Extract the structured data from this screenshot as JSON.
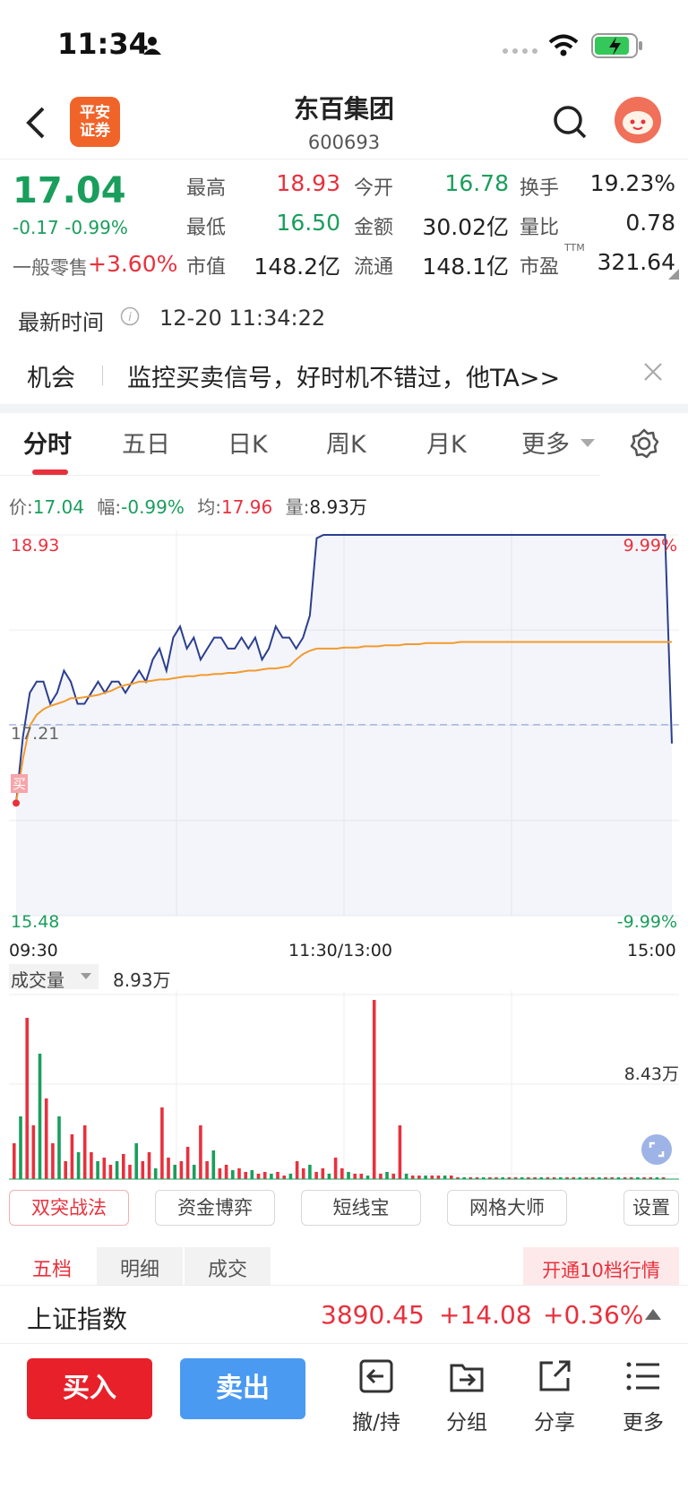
{
  "status_bar": {
    "time": "11:34"
  },
  "header": {
    "title": "东百集团",
    "code": "600693",
    "broker_logo": "平安证券",
    "broker_line1": "平安",
    "broker_line2": "证券"
  },
  "quote": {
    "price": "17.04",
    "change": "-0.17 -0.99%",
    "retail_label": "一般零售",
    "retail_change": "+3.60%",
    "high_label": "最高",
    "high": "18.93",
    "open_label": "今开",
    "open": "16.78",
    "turnover_label": "换手",
    "turnover": "19.23%",
    "low_label": "最低",
    "low": "16.50",
    "amount_label": "金额",
    "amount": "30.02亿",
    "vol_ratio_label": "量比",
    "vol_ratio": "0.78",
    "mcap_label": "市值",
    "mcap": "148.2亿",
    "float_label": "流通",
    "float": "148.1亿",
    "pe_label": "市盈",
    "pe_sup": "TTM",
    "pe": "321.64"
  },
  "update": {
    "label": "最新时间",
    "time": "12-20 11:34:22"
  },
  "banner": {
    "tag": "机会",
    "text": "监控买卖信号，好时机不错过，他TA>>"
  },
  "tabs": [
    "分时",
    "五日",
    "日K",
    "周K",
    "月K",
    "更多"
  ],
  "chart_info": {
    "price_label": "价:",
    "price": "17.04",
    "amp_label": "幅:",
    "amp": "-0.99%",
    "avg_label": "均:",
    "avg": "17.96",
    "vol_label": "量:",
    "vol": "8.93万"
  },
  "chart_data": {
    "type": "line",
    "y_top": "18.93",
    "y_mid": "17.21",
    "y_bottom": "15.48",
    "pct_top": "9.99%",
    "pct_bottom": "-9.99%",
    "x_labels": [
      "09:30",
      "11:30/13:00",
      "15:00"
    ],
    "buy_marker": "买",
    "ylim": [
      15.48,
      18.93
    ],
    "series": [
      {
        "values": [
          16.5,
          17.1,
          17.5,
          17.6,
          17.6,
          17.4,
          17.5,
          17.7,
          17.6,
          17.4,
          17.4,
          17.5,
          17.6,
          17.5,
          17.6,
          17.6,
          17.5,
          17.6,
          17.7,
          17.6,
          17.8,
          17.9,
          17.7,
          18.0,
          18.1,
          17.9,
          18.0,
          17.8,
          17.9,
          18.0,
          18.0,
          17.9,
          17.9,
          18.0,
          17.9,
          18.0,
          17.8,
          17.9,
          18.1,
          18.0,
          18.0,
          17.9,
          18.0,
          18.2,
          18.9,
          18.93,
          18.93,
          18.93,
          18.93,
          18.93,
          18.93,
          18.93,
          18.93,
          18.93,
          18.93,
          18.93,
          18.93,
          18.93,
          18.93,
          18.93,
          18.93,
          18.93,
          18.93,
          18.93,
          18.93,
          18.93,
          18.93,
          18.93,
          18.93,
          18.93,
          18.93,
          18.93,
          18.93,
          18.93,
          18.93,
          18.93,
          18.93,
          18.93,
          18.93,
          18.93,
          18.93,
          18.93,
          18.93,
          18.93,
          18.93,
          18.93,
          18.93,
          18.93,
          18.93,
          18.93,
          18.93,
          18.93,
          18.93,
          18.93,
          18.93,
          18.93,
          17.04
        ]
      },
      {
        "values": [
          16.5,
          16.9,
          17.2,
          17.3,
          17.35,
          17.38,
          17.4,
          17.42,
          17.45,
          17.45,
          17.46,
          17.47,
          17.48,
          17.5,
          17.52,
          17.55,
          17.57,
          17.58,
          17.6,
          17.6,
          17.61,
          17.62,
          17.62,
          17.63,
          17.64,
          17.65,
          17.65,
          17.66,
          17.66,
          17.67,
          17.67,
          17.68,
          17.68,
          17.69,
          17.7,
          17.7,
          17.71,
          17.72,
          17.72,
          17.73,
          17.74,
          17.8,
          17.85,
          17.88,
          17.9,
          17.9,
          17.9,
          17.9,
          17.91,
          17.91,
          17.91,
          17.92,
          17.92,
          17.92,
          17.93,
          17.93,
          17.93,
          17.94,
          17.94,
          17.94,
          17.95,
          17.95,
          17.95,
          17.95,
          17.95,
          17.96,
          17.96,
          17.96,
          17.96,
          17.96,
          17.96,
          17.96,
          17.96,
          17.96,
          17.96,
          17.96,
          17.96,
          17.96,
          17.96,
          17.96,
          17.96,
          17.96,
          17.96,
          17.96,
          17.96,
          17.96,
          17.96,
          17.96,
          17.96,
          17.96,
          17.96,
          17.96,
          17.96,
          17.96,
          17.96,
          17.96,
          17.96
        ]
      }
    ],
    "volume": {
      "label": "成交量",
      "value": "8.93万",
      "axis_max_label": "8.43万",
      "bars": [
        20,
        35,
        90,
        30,
        70,
        45,
        20,
        35,
        10,
        25,
        15,
        30,
        15,
        10,
        12,
        8,
        10,
        14,
        8,
        20,
        10,
        15,
        6,
        40,
        12,
        8,
        10,
        18,
        8,
        30,
        10,
        16,
        6,
        8,
        5,
        6,
        4,
        5,
        3,
        4,
        3,
        4,
        2,
        3,
        10,
        6,
        8,
        4,
        6,
        3,
        12,
        6,
        4,
        3,
        3,
        2,
        100,
        3,
        4,
        3,
        30,
        3,
        2,
        2,
        2,
        2,
        2,
        2,
        2,
        1,
        1,
        1,
        1,
        1,
        1,
        1,
        1,
        1,
        1,
        1,
        1,
        1,
        1,
        1,
        1,
        1,
        1,
        1,
        1,
        1,
        1,
        1,
        1,
        1,
        1,
        1,
        1,
        1,
        1,
        1,
        1,
        1
      ]
    }
  },
  "feature_buttons": [
    "双突战法",
    "资金博弈",
    "短线宝",
    "网格大师",
    "设置"
  ],
  "detail_tabs": [
    "五档",
    "明细",
    "成交"
  ],
  "upgrade_btn": "开通10档行情",
  "index_bar": {
    "name": "上证指数",
    "value": "3890.45",
    "change": "+14.08",
    "pct": "+0.36%"
  },
  "bottom": {
    "buy": "买入",
    "sell": "卖出",
    "cancel": "撤/持",
    "group": "分组",
    "share": "分享",
    "more": "更多"
  }
}
